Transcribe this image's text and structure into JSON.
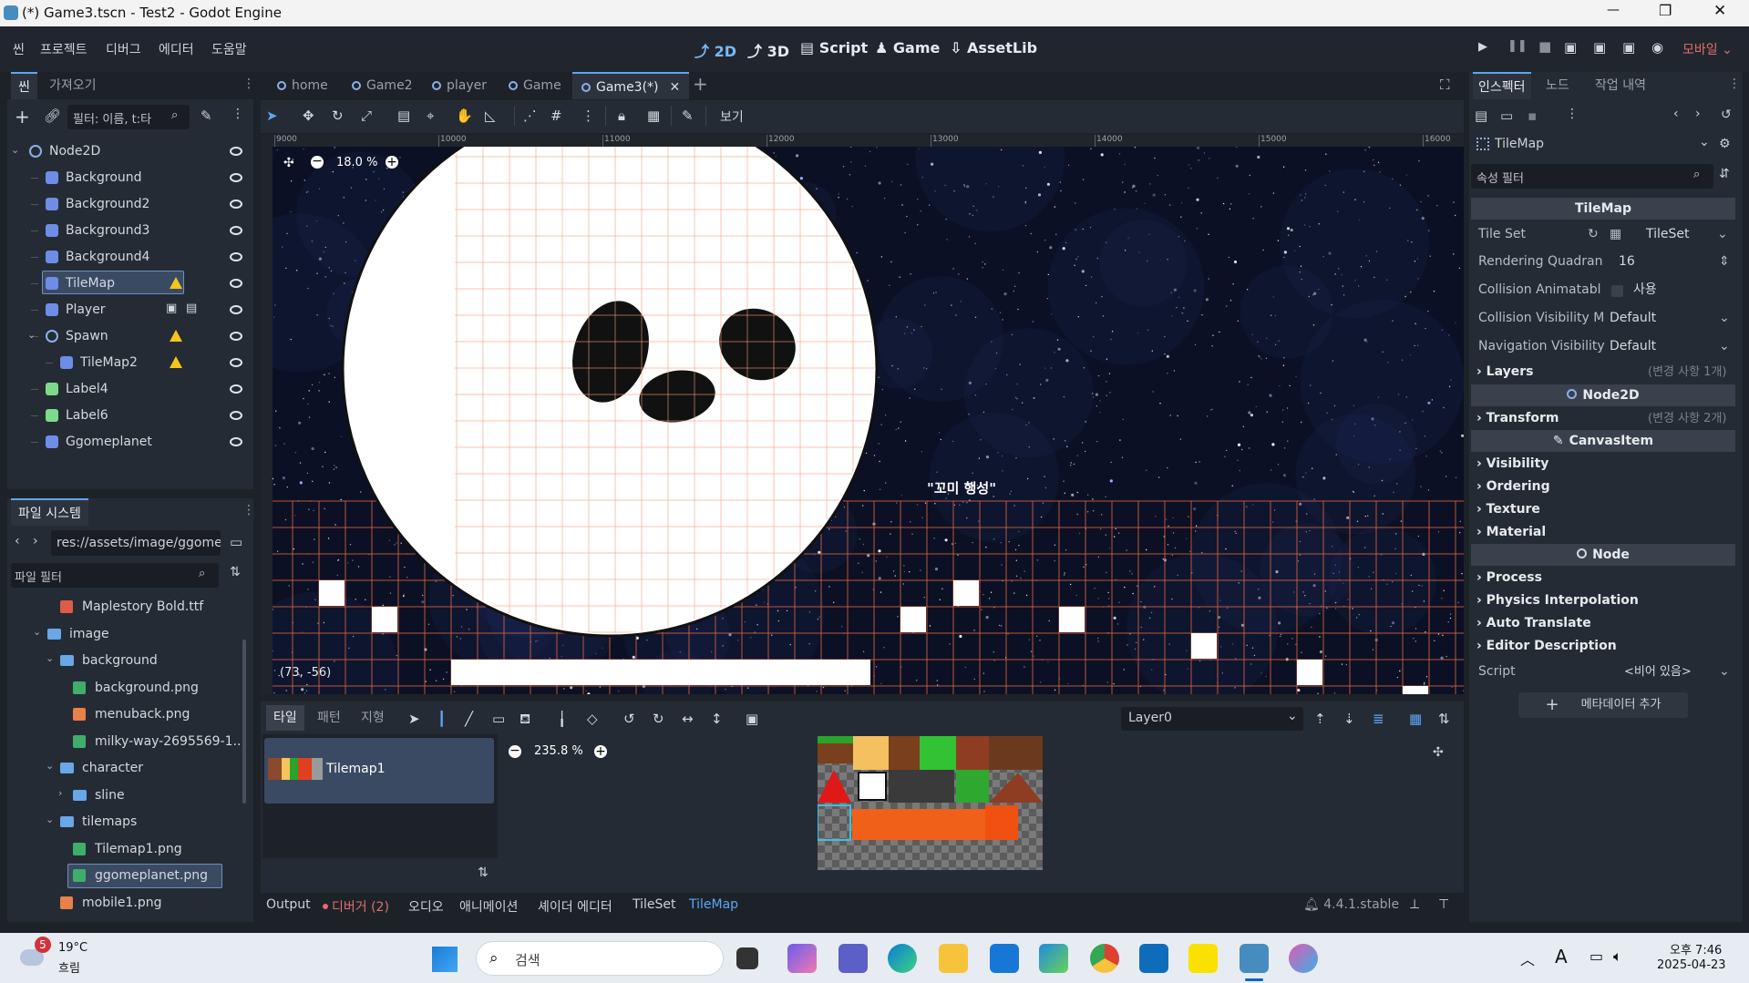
{
  "window": {
    "title": "(*) Game3.tscn - Test2 - Godot Engine",
    "min": "—",
    "max": "❐",
    "close": "✕"
  },
  "menu": {
    "items": [
      "씬",
      "프로젝트",
      "디버그",
      "에디터",
      "도움말"
    ],
    "modes": [
      "2D",
      "3D",
      "Script",
      "Game",
      "AssetLib"
    ],
    "mobile": "모바일"
  },
  "scene_panel": {
    "tabs": [
      "씬",
      "가져오기"
    ],
    "filter_placeholder": "필터: 이름, t:타",
    "nodes": [
      {
        "label": "Node2D",
        "depth": 0,
        "type": "node2d"
      },
      {
        "label": "Background",
        "depth": 1,
        "type": "sprite"
      },
      {
        "label": "Background2",
        "depth": 1,
        "type": "sprite"
      },
      {
        "label": "Background3",
        "depth": 1,
        "type": "sprite"
      },
      {
        "label": "Background4",
        "depth": 1,
        "type": "sprite"
      },
      {
        "label": "TileMap",
        "depth": 1,
        "type": "tilemap",
        "warn": true,
        "selected": true
      },
      {
        "label": "Player",
        "depth": 1,
        "type": "player"
      },
      {
        "label": "Spawn",
        "depth": 1,
        "type": "spawn",
        "warn": true
      },
      {
        "label": "TileMap2",
        "depth": 2,
        "type": "tilemap",
        "warn": true
      },
      {
        "label": "Label4",
        "depth": 1,
        "type": "label"
      },
      {
        "label": "Label6",
        "depth": 1,
        "type": "label"
      },
      {
        "label": "Ggomeplanet",
        "depth": 1,
        "type": "sprite"
      }
    ]
  },
  "filesystem": {
    "tab": "파일 시스템",
    "path": "res://assets/image/ggome",
    "filter_placeholder": "파일 필터",
    "items": [
      {
        "label": "Maplestory Bold.ttf",
        "indent": 3,
        "kind": "font"
      },
      {
        "label": "image",
        "indent": 2,
        "kind": "folder"
      },
      {
        "label": "background",
        "indent": 3,
        "kind": "folder"
      },
      {
        "label": "background.png",
        "indent": 4,
        "kind": "image"
      },
      {
        "label": "menuback.png",
        "indent": 4,
        "kind": "image"
      },
      {
        "label": "milky-way-2695569-1....",
        "indent": 4,
        "kind": "image"
      },
      {
        "label": "character",
        "indent": 3,
        "kind": "folder"
      },
      {
        "label": "sline",
        "indent": 4,
        "kind": "folder"
      },
      {
        "label": "tilemaps",
        "indent": 3,
        "kind": "folder"
      },
      {
        "label": "Tilemap1.png",
        "indent": 4,
        "kind": "image"
      },
      {
        "label": "ggomeplanet.png",
        "indent": 4,
        "kind": "image",
        "selected": true
      },
      {
        "label": "mobile1.png",
        "indent": 3,
        "kind": "image"
      }
    ]
  },
  "editor_tabs": [
    "home",
    "Game2",
    "player",
    "Game",
    "Game3(*)"
  ],
  "viewport": {
    "view_label": "보기",
    "zoom": "18.0 %",
    "coords": "(73, -56)",
    "ruler": [
      "9000",
      "10000",
      "11000",
      "12000",
      "13000",
      "14000",
      "15000",
      "16000"
    ],
    "planet_label": "\"꼬미 행성\""
  },
  "tilemap_panel": {
    "tabs": [
      "타일",
      "패턴",
      "지형"
    ],
    "layer": "Layer0",
    "zoom": "235.8 %",
    "source": "Tilemap1"
  },
  "bottom_bar": {
    "items": [
      "Output",
      "디버거 (2)",
      "오디오",
      "애니메이션",
      "셰이더 에디터",
      "TileSet",
      "TileMap"
    ],
    "version": "4.4.1.stable"
  },
  "inspector": {
    "tabs": [
      "인스펙터",
      "노드",
      "작업 내역"
    ],
    "object": "TileMap",
    "filter_placeholder": "속성 필터",
    "class_tilemap": "TileMap",
    "tile_set_label": "Tile Set",
    "tile_set_value": "TileSet",
    "rendering_label": "Rendering Quadran",
    "rendering_value": "16",
    "collision_anim_label": "Collision Animatabl",
    "collision_anim_value": "사용",
    "collision_vis_label": "Collision Visibility M",
    "collision_vis_value": "Default",
    "nav_vis_label": "Navigation Visibility",
    "nav_vis_value": "Default",
    "layers": "Layers",
    "layers_note": "(변경 사항 1개)",
    "class_node2d": "Node2D",
    "transform": "Transform",
    "transform_note": "(변경 사항 2개)",
    "class_canvas": "CanvasItem",
    "canvas_items": [
      "Visibility",
      "Ordering",
      "Texture",
      "Material"
    ],
    "class_node": "Node",
    "node_items": [
      "Process",
      "Physics Interpolation",
      "Auto Translate",
      "Editor Description"
    ],
    "script_label": "Script",
    "script_value": "<비어 있음>",
    "add_meta": "메타데이터 추가"
  },
  "taskbar": {
    "temp": "19°C",
    "weather": "흐림",
    "badge": "5",
    "search": "검색",
    "time": "오후 7:46",
    "date": "2025-04-23",
    "lang": "A"
  }
}
